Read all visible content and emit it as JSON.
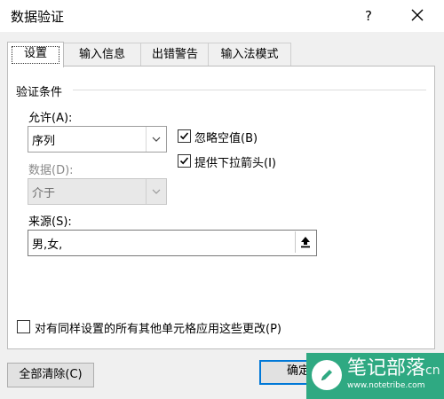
{
  "window": {
    "title": "数据验证",
    "help_label": "?",
    "close_label": "✕"
  },
  "tabs": [
    {
      "label": "设置",
      "active": true
    },
    {
      "label": "输入信息",
      "active": false
    },
    {
      "label": "出错警告",
      "active": false
    },
    {
      "label": "输入法模式",
      "active": false
    }
  ],
  "settings": {
    "group_title": "验证条件",
    "allow_label": "允许(A):",
    "allow_value": "序列",
    "ignore_blank_label": "忽略空值(B)",
    "ignore_blank_checked": true,
    "in_cell_dropdown_label": "提供下拉箭头(I)",
    "in_cell_dropdown_checked": true,
    "data_label": "数据(D):",
    "data_value": "介于",
    "source_label": "来源(S):",
    "source_value": "男,女,",
    "apply_all_label": "对有同样设置的所有其他单元格应用这些更改(P)",
    "apply_all_checked": false
  },
  "footer": {
    "clear_all_label": "全部清除(C)",
    "ok_label": "确定"
  },
  "watermark": {
    "title": "笔记部落",
    "url": "www.notetribe.com",
    "cn_suffix": "cn"
  },
  "icons": {
    "dropdown": "chevron-down-icon",
    "collapse": "collapse-dialog-icon",
    "checkmark": "checkmark-icon",
    "pen": "pen-icon"
  }
}
